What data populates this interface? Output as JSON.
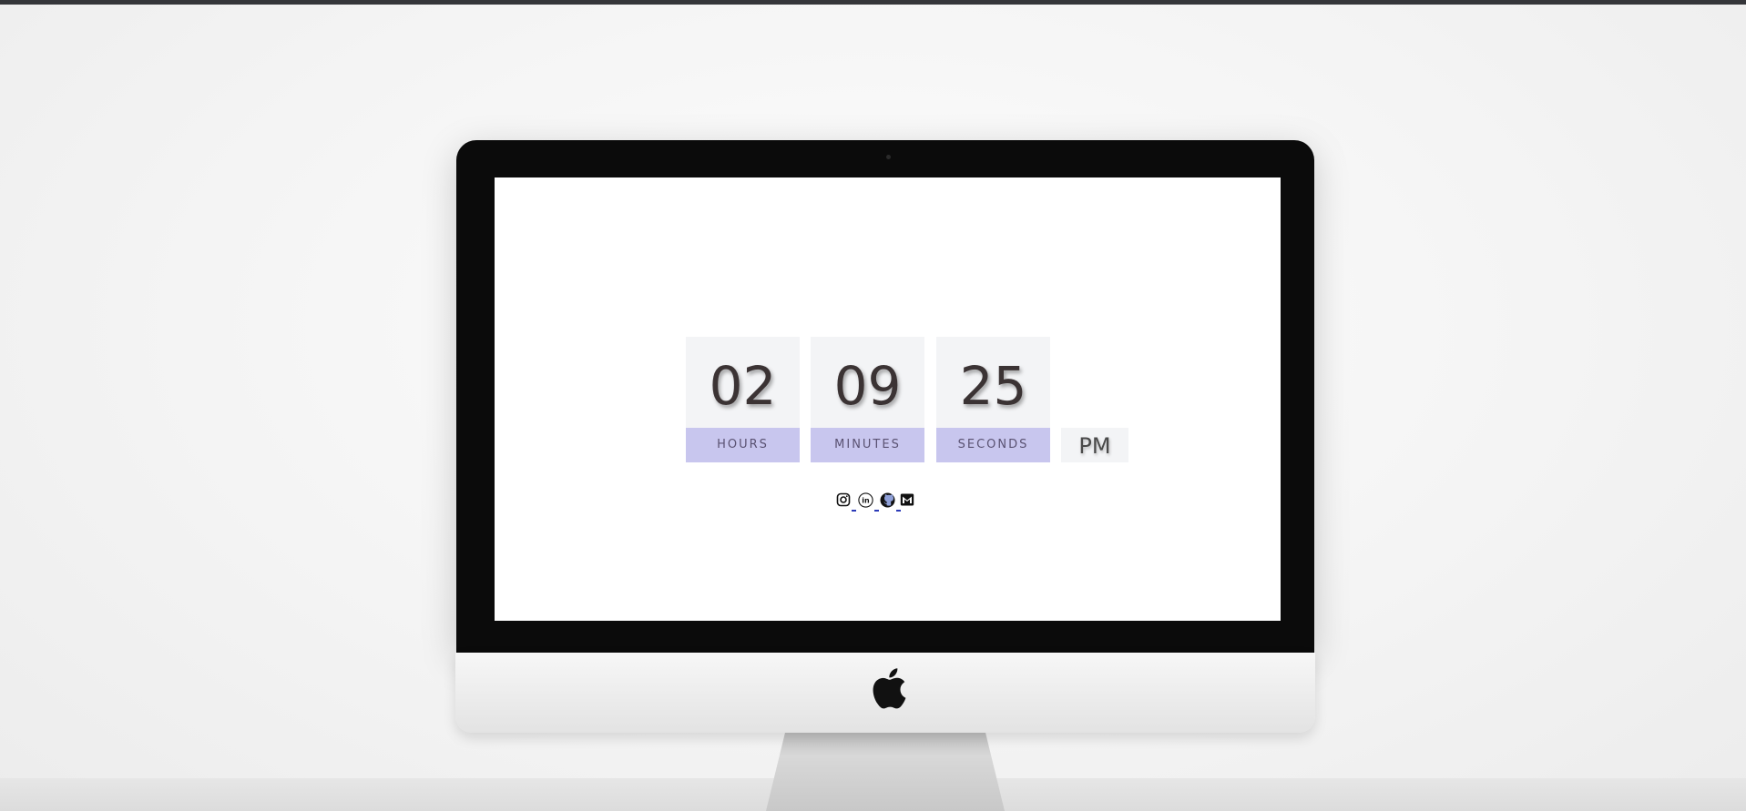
{
  "clock": {
    "hours": "02",
    "minutes": "09",
    "seconds": "25",
    "period": "PM",
    "labels": {
      "hours": "HOURS",
      "minutes": "MINUTES",
      "seconds": "SECONDS"
    }
  },
  "social_links": [
    {
      "name": "instagram",
      "icon": "instagram-icon"
    },
    {
      "name": "linkedin",
      "icon": "linkedin-icon"
    },
    {
      "name": "github",
      "icon": "github-icon"
    },
    {
      "name": "gmail",
      "icon": "gmail-icon"
    }
  ],
  "colors": {
    "label_background": "#c8c6ee",
    "digit_background": "#f3f4f6",
    "digit_color": "#3b3334",
    "link_underline": "#2b3ab8"
  }
}
